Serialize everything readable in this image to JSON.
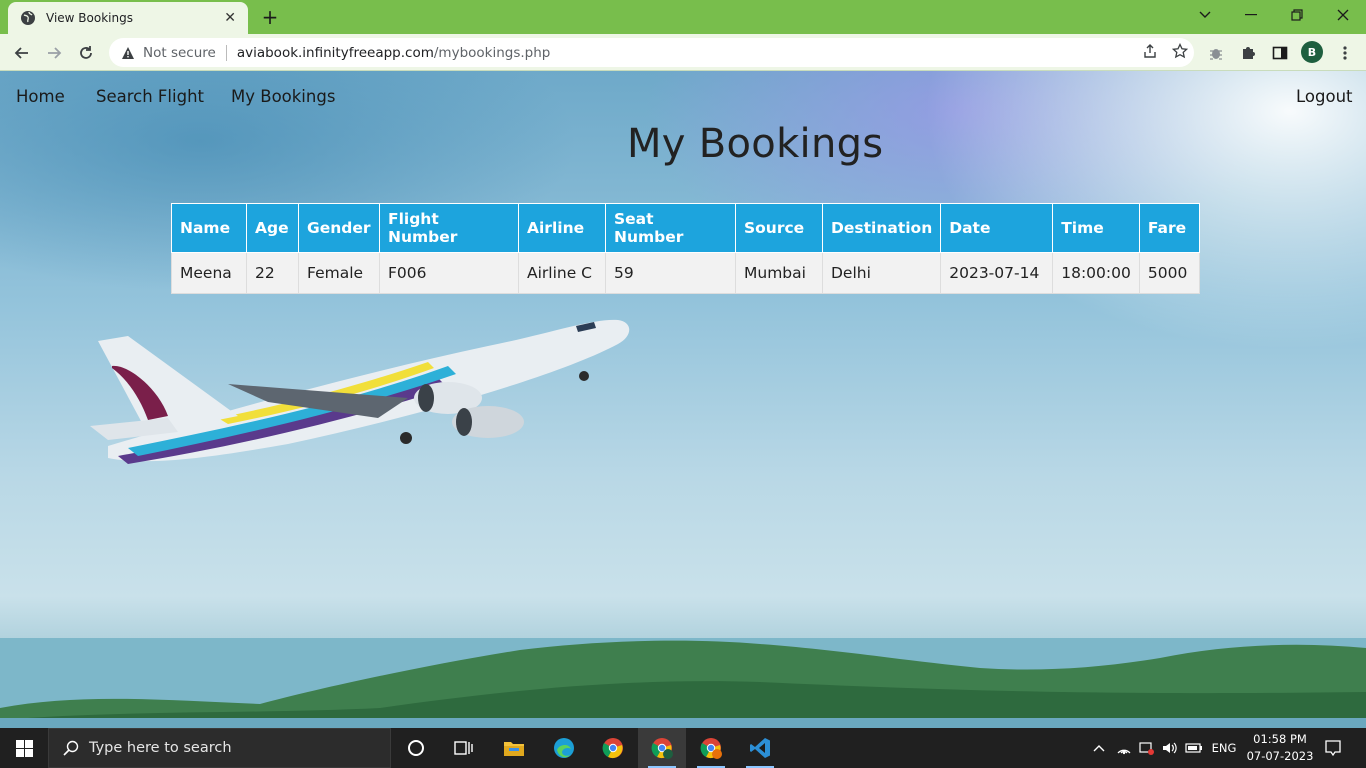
{
  "browser": {
    "tab_title": "View Bookings",
    "new_tab": "+",
    "security_label": "Not secure",
    "url_domain": "aviabook.infinityfreeapp.com",
    "url_path": "/mybookings.php",
    "profile_initial": "B"
  },
  "nav": {
    "home": "Home",
    "search_flight": "Search Flight",
    "my_bookings": "My Bookings",
    "logout": "Logout"
  },
  "page": {
    "heading": "My Bookings"
  },
  "bookings": {
    "columns": [
      "Name",
      "Age",
      "Gender",
      "Flight Number",
      "Airline",
      "Seat Number",
      "Source",
      "Destination",
      "Date",
      "Time",
      "Fare"
    ],
    "rows": [
      [
        "Meena",
        "22",
        "Female",
        "F006",
        "Airline C",
        "59",
        "Mumbai",
        "Delhi",
        "2023-07-14",
        "18:00:00",
        "5000"
      ]
    ]
  },
  "taskbar": {
    "search_placeholder": "Type here to search",
    "language": "ENG",
    "time": "01:58 PM",
    "date": "07-07-2023"
  },
  "colors": {
    "tab_bar": "#78be4c",
    "table_header": "#1da4dd",
    "table_row": "#f2f2f2"
  }
}
